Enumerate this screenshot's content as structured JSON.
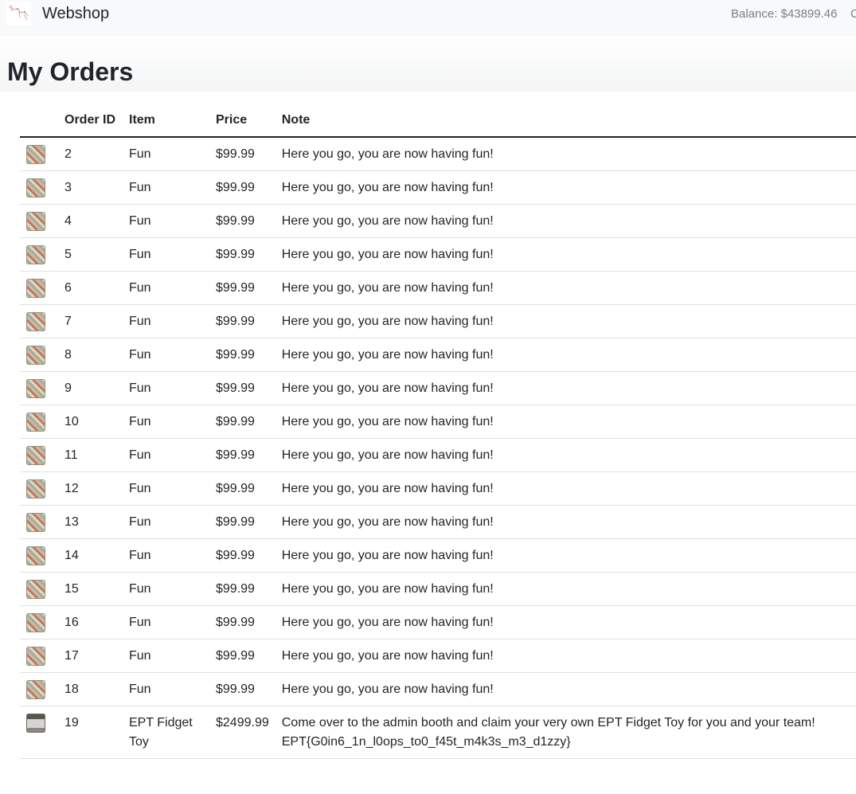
{
  "nav": {
    "brand": "Webshop",
    "balance": "Balance: $43899.46",
    "cutoff_item": "C"
  },
  "page": {
    "title": "My Orders"
  },
  "table": {
    "headers": [
      "",
      "Order ID",
      "Item",
      "Price",
      "Note"
    ],
    "rows": [
      {
        "icon": "fun-thumbnail",
        "id": "2",
        "item": "Fun",
        "price": "$99.99",
        "note": "Here you go, you are now having fun!"
      },
      {
        "icon": "fun-thumbnail",
        "id": "3",
        "item": "Fun",
        "price": "$99.99",
        "note": "Here you go, you are now having fun!"
      },
      {
        "icon": "fun-thumbnail",
        "id": "4",
        "item": "Fun",
        "price": "$99.99",
        "note": "Here you go, you are now having fun!"
      },
      {
        "icon": "fun-thumbnail",
        "id": "5",
        "item": "Fun",
        "price": "$99.99",
        "note": "Here you go, you are now having fun!"
      },
      {
        "icon": "fun-thumbnail",
        "id": "6",
        "item": "Fun",
        "price": "$99.99",
        "note": "Here you go, you are now having fun!"
      },
      {
        "icon": "fun-thumbnail",
        "id": "7",
        "item": "Fun",
        "price": "$99.99",
        "note": "Here you go, you are now having fun!"
      },
      {
        "icon": "fun-thumbnail",
        "id": "8",
        "item": "Fun",
        "price": "$99.99",
        "note": "Here you go, you are now having fun!"
      },
      {
        "icon": "fun-thumbnail",
        "id": "9",
        "item": "Fun",
        "price": "$99.99",
        "note": "Here you go, you are now having fun!"
      },
      {
        "icon": "fun-thumbnail",
        "id": "10",
        "item": "Fun",
        "price": "$99.99",
        "note": "Here you go, you are now having fun!"
      },
      {
        "icon": "fun-thumbnail",
        "id": "11",
        "item": "Fun",
        "price": "$99.99",
        "note": "Here you go, you are now having fun!"
      },
      {
        "icon": "fun-thumbnail",
        "id": "12",
        "item": "Fun",
        "price": "$99.99",
        "note": "Here you go, you are now having fun!"
      },
      {
        "icon": "fun-thumbnail",
        "id": "13",
        "item": "Fun",
        "price": "$99.99",
        "note": "Here you go, you are now having fun!"
      },
      {
        "icon": "fun-thumbnail",
        "id": "14",
        "item": "Fun",
        "price": "$99.99",
        "note": "Here you go, you are now having fun!"
      },
      {
        "icon": "fun-thumbnail",
        "id": "15",
        "item": "Fun",
        "price": "$99.99",
        "note": "Here you go, you are now having fun!"
      },
      {
        "icon": "fun-thumbnail",
        "id": "16",
        "item": "Fun",
        "price": "$99.99",
        "note": "Here you go, you are now having fun!"
      },
      {
        "icon": "fun-thumbnail",
        "id": "17",
        "item": "Fun",
        "price": "$99.99",
        "note": "Here you go, you are now having fun!"
      },
      {
        "icon": "fun-thumbnail",
        "id": "18",
        "item": "Fun",
        "price": "$99.99",
        "note": "Here you go, you are now having fun!"
      }
    ],
    "last_row": {
      "icon": "ept-fidget-toy-thumbnail",
      "id": "19",
      "item_line1": "EPT Fidget",
      "item_line2": "Toy",
      "price": "$2499.99",
      "note_line1": "Come over to the admin booth and claim your very own EPT Fidget Toy for you and your team!",
      "note_line2": "EPT{G0in6_1n_l0ops_to0_f45t_m4k3s_m3_d1zzy}"
    }
  }
}
